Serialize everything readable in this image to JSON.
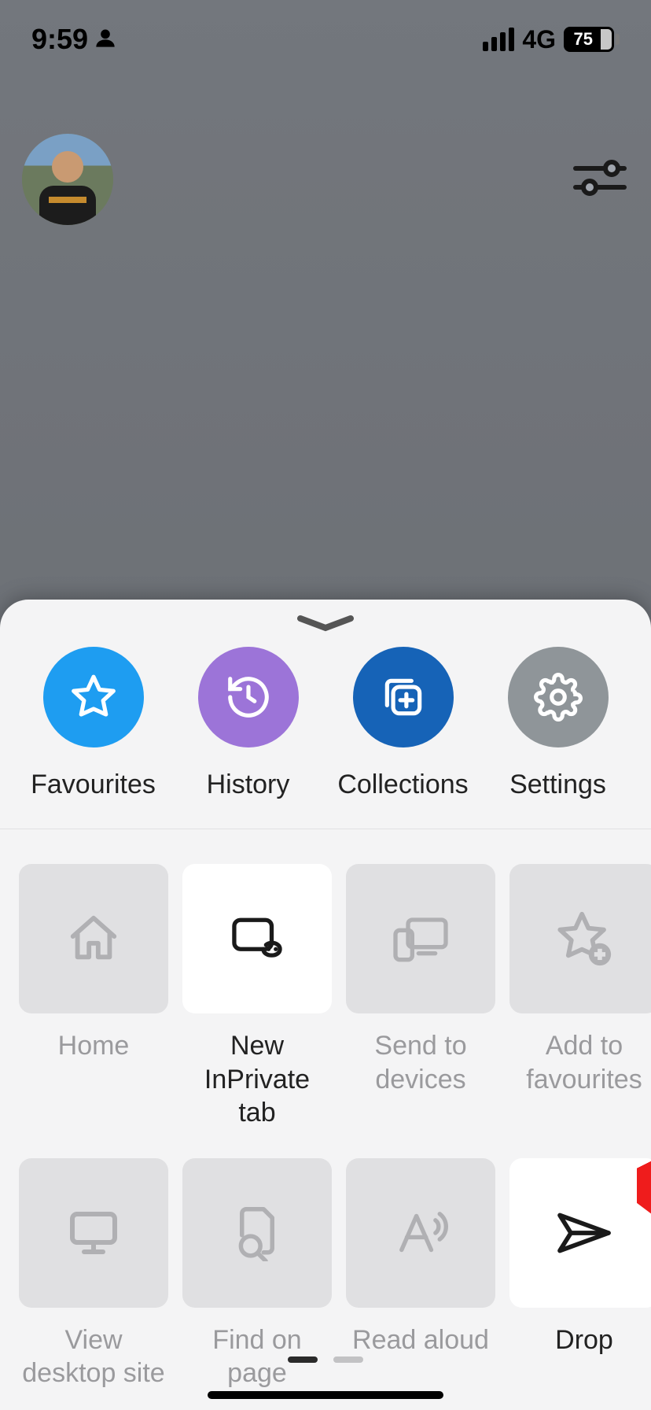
{
  "status": {
    "time": "9:59",
    "network_label": "4G",
    "battery_percent": "75"
  },
  "page": {
    "brand": "Microsoft"
  },
  "sheet": {
    "top_row": [
      {
        "id": "favourites",
        "label": "Favourites"
      },
      {
        "id": "history",
        "label": "History"
      },
      {
        "id": "collections",
        "label": "Collections"
      },
      {
        "id": "settings",
        "label": "Settings"
      }
    ],
    "grid": [
      {
        "id": "home",
        "label": "Home",
        "enabled": false
      },
      {
        "id": "new-inprivate",
        "label": "New InPrivate tab",
        "enabled": true
      },
      {
        "id": "send-devices",
        "label": "Send to devices",
        "enabled": false
      },
      {
        "id": "add-fav",
        "label": "Add to favourites",
        "enabled": false
      },
      {
        "id": "view-desktop",
        "label": "View desktop site",
        "enabled": false
      },
      {
        "id": "find-page",
        "label": "Find on page",
        "enabled": false
      },
      {
        "id": "read-aloud",
        "label": "Read aloud",
        "enabled": false
      },
      {
        "id": "drop",
        "label": "Drop",
        "enabled": true
      }
    ],
    "page_indicator": {
      "current": 1,
      "total": 2
    }
  }
}
